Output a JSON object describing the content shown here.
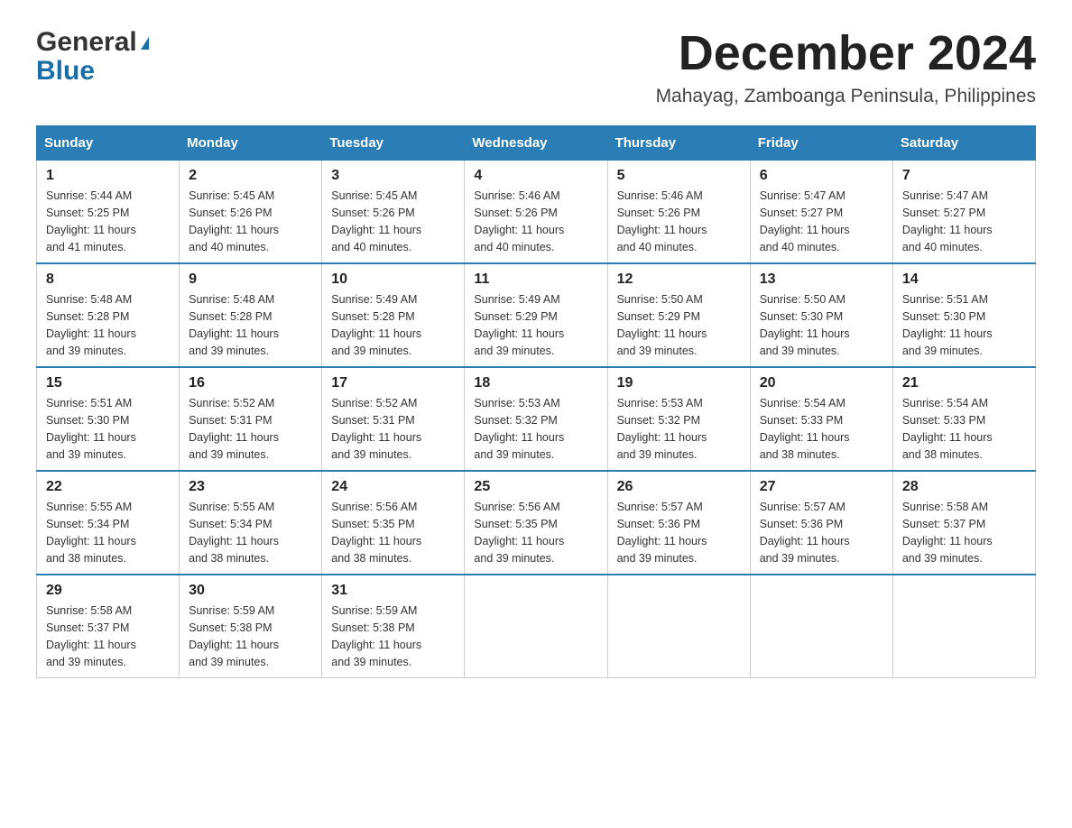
{
  "header": {
    "logo_general": "General",
    "logo_blue": "Blue",
    "month_title": "December 2024",
    "location": "Mahayag, Zamboanga Peninsula, Philippines"
  },
  "days_of_week": [
    "Sunday",
    "Monday",
    "Tuesday",
    "Wednesday",
    "Thursday",
    "Friday",
    "Saturday"
  ],
  "weeks": [
    [
      {
        "day": "1",
        "sunrise": "5:44 AM",
        "sunset": "5:25 PM",
        "daylight": "11 hours and 41 minutes."
      },
      {
        "day": "2",
        "sunrise": "5:45 AM",
        "sunset": "5:26 PM",
        "daylight": "11 hours and 40 minutes."
      },
      {
        "day": "3",
        "sunrise": "5:45 AM",
        "sunset": "5:26 PM",
        "daylight": "11 hours and 40 minutes."
      },
      {
        "day": "4",
        "sunrise": "5:46 AM",
        "sunset": "5:26 PM",
        "daylight": "11 hours and 40 minutes."
      },
      {
        "day": "5",
        "sunrise": "5:46 AM",
        "sunset": "5:26 PM",
        "daylight": "11 hours and 40 minutes."
      },
      {
        "day": "6",
        "sunrise": "5:47 AM",
        "sunset": "5:27 PM",
        "daylight": "11 hours and 40 minutes."
      },
      {
        "day": "7",
        "sunrise": "5:47 AM",
        "sunset": "5:27 PM",
        "daylight": "11 hours and 40 minutes."
      }
    ],
    [
      {
        "day": "8",
        "sunrise": "5:48 AM",
        "sunset": "5:28 PM",
        "daylight": "11 hours and 39 minutes."
      },
      {
        "day": "9",
        "sunrise": "5:48 AM",
        "sunset": "5:28 PM",
        "daylight": "11 hours and 39 minutes."
      },
      {
        "day": "10",
        "sunrise": "5:49 AM",
        "sunset": "5:28 PM",
        "daylight": "11 hours and 39 minutes."
      },
      {
        "day": "11",
        "sunrise": "5:49 AM",
        "sunset": "5:29 PM",
        "daylight": "11 hours and 39 minutes."
      },
      {
        "day": "12",
        "sunrise": "5:50 AM",
        "sunset": "5:29 PM",
        "daylight": "11 hours and 39 minutes."
      },
      {
        "day": "13",
        "sunrise": "5:50 AM",
        "sunset": "5:30 PM",
        "daylight": "11 hours and 39 minutes."
      },
      {
        "day": "14",
        "sunrise": "5:51 AM",
        "sunset": "5:30 PM",
        "daylight": "11 hours and 39 minutes."
      }
    ],
    [
      {
        "day": "15",
        "sunrise": "5:51 AM",
        "sunset": "5:30 PM",
        "daylight": "11 hours and 39 minutes."
      },
      {
        "day": "16",
        "sunrise": "5:52 AM",
        "sunset": "5:31 PM",
        "daylight": "11 hours and 39 minutes."
      },
      {
        "day": "17",
        "sunrise": "5:52 AM",
        "sunset": "5:31 PM",
        "daylight": "11 hours and 39 minutes."
      },
      {
        "day": "18",
        "sunrise": "5:53 AM",
        "sunset": "5:32 PM",
        "daylight": "11 hours and 39 minutes."
      },
      {
        "day": "19",
        "sunrise": "5:53 AM",
        "sunset": "5:32 PM",
        "daylight": "11 hours and 39 minutes."
      },
      {
        "day": "20",
        "sunrise": "5:54 AM",
        "sunset": "5:33 PM",
        "daylight": "11 hours and 38 minutes."
      },
      {
        "day": "21",
        "sunrise": "5:54 AM",
        "sunset": "5:33 PM",
        "daylight": "11 hours and 38 minutes."
      }
    ],
    [
      {
        "day": "22",
        "sunrise": "5:55 AM",
        "sunset": "5:34 PM",
        "daylight": "11 hours and 38 minutes."
      },
      {
        "day": "23",
        "sunrise": "5:55 AM",
        "sunset": "5:34 PM",
        "daylight": "11 hours and 38 minutes."
      },
      {
        "day": "24",
        "sunrise": "5:56 AM",
        "sunset": "5:35 PM",
        "daylight": "11 hours and 38 minutes."
      },
      {
        "day": "25",
        "sunrise": "5:56 AM",
        "sunset": "5:35 PM",
        "daylight": "11 hours and 39 minutes."
      },
      {
        "day": "26",
        "sunrise": "5:57 AM",
        "sunset": "5:36 PM",
        "daylight": "11 hours and 39 minutes."
      },
      {
        "day": "27",
        "sunrise": "5:57 AM",
        "sunset": "5:36 PM",
        "daylight": "11 hours and 39 minutes."
      },
      {
        "day": "28",
        "sunrise": "5:58 AM",
        "sunset": "5:37 PM",
        "daylight": "11 hours and 39 minutes."
      }
    ],
    [
      {
        "day": "29",
        "sunrise": "5:58 AM",
        "sunset": "5:37 PM",
        "daylight": "11 hours and 39 minutes."
      },
      {
        "day": "30",
        "sunrise": "5:59 AM",
        "sunset": "5:38 PM",
        "daylight": "11 hours and 39 minutes."
      },
      {
        "day": "31",
        "sunrise": "5:59 AM",
        "sunset": "5:38 PM",
        "daylight": "11 hours and 39 minutes."
      },
      null,
      null,
      null,
      null
    ]
  ],
  "labels": {
    "sunrise": "Sunrise:",
    "sunset": "Sunset:",
    "daylight": "Daylight:"
  }
}
